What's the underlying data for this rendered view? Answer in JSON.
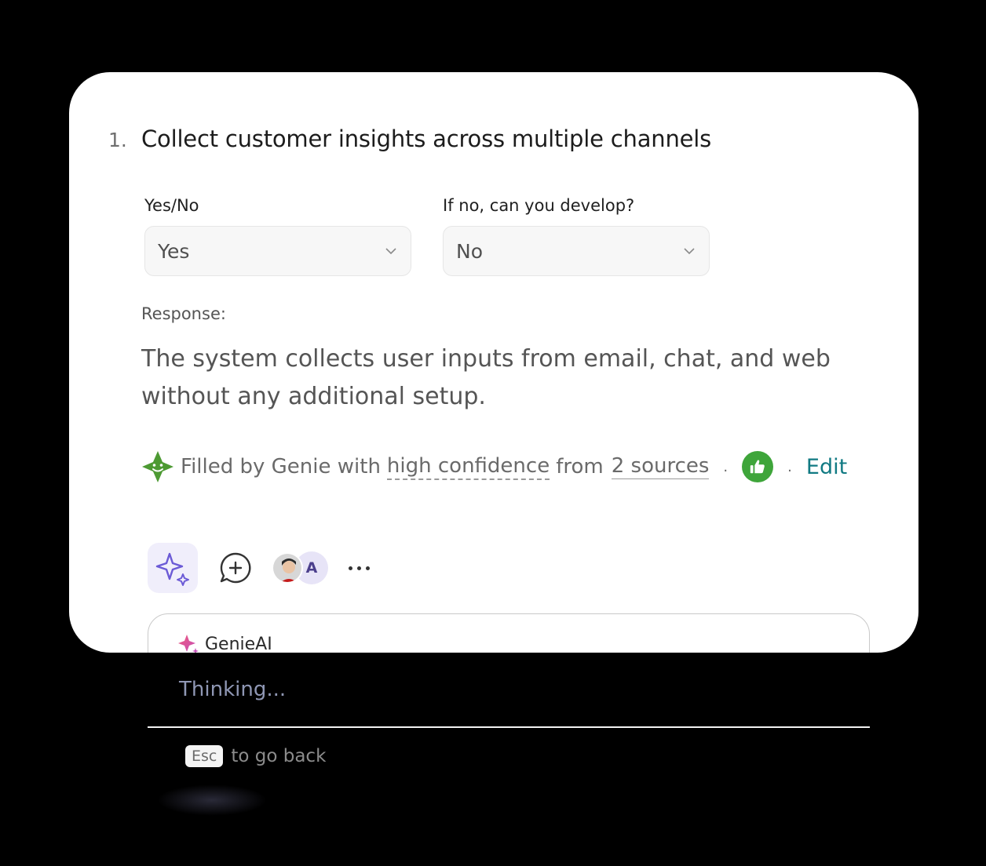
{
  "question": {
    "number": "1.",
    "title": "Collect customer insights across multiple channels"
  },
  "fields": {
    "yes_no": {
      "label": "Yes/No",
      "value": "Yes"
    },
    "develop": {
      "label": "If no, can you develop?",
      "value": "No"
    }
  },
  "response": {
    "label": "Response:",
    "text": "The system collects user inputs from email, chat, and web without any additional setup."
  },
  "filled": {
    "prefix": "Filled by Genie with",
    "confidence_link": "high confidence",
    "from_text": "from",
    "sources_link": "2 sources",
    "separator": ".",
    "edit_label": "Edit"
  },
  "toolbar": {
    "avatar_initial": "A"
  },
  "genie": {
    "name": "GenieAI",
    "status": "Thinking...",
    "esc_key": "Esc",
    "esc_hint": "to go back"
  },
  "colors": {
    "accent_teal": "#117a83",
    "thumb_green": "#3ea53a",
    "ai_purple": "#6b5ad6"
  }
}
